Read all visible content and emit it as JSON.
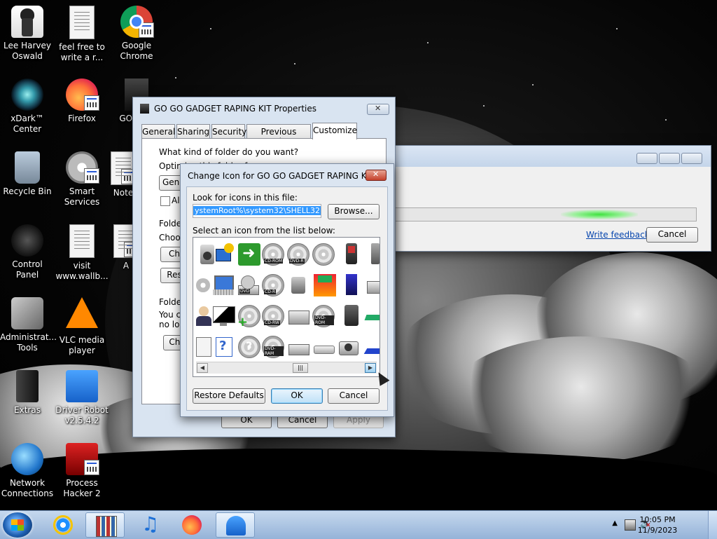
{
  "desktop": {
    "icons": [
      {
        "label": "Lee Harvey Oswald",
        "icon": "person-icon"
      },
      {
        "label": "feel free to write a r...",
        "icon": "text-document-icon"
      },
      {
        "label": "Google Chrome",
        "icon": "chrome-icon"
      },
      {
        "label": "xDark™ Center",
        "icon": "xdark-icon"
      },
      {
        "label": "Firefox",
        "icon": "firefox-icon"
      },
      {
        "label": "GO GAD",
        "icon": "folder-icon"
      },
      {
        "label": "Recycle Bin",
        "icon": "recycle-bin-icon"
      },
      {
        "label": "Smart Services",
        "icon": "gear-icon"
      },
      {
        "label": "Note",
        "icon": "shortcut-icon"
      },
      {
        "label": "Control Panel",
        "icon": "control-panel-icon"
      },
      {
        "label": "visit www.wallb...",
        "icon": "text-document-icon"
      },
      {
        "label": "A",
        "icon": "shortcut-icon"
      },
      {
        "label": "Administrat... Tools",
        "icon": "admin-tools-icon"
      },
      {
        "label": "VLC media player",
        "icon": "vlc-icon"
      },
      {
        "label": "Extras",
        "icon": "extras-icon"
      },
      {
        "label": "Driver Robot v2.5.4.2",
        "icon": "driver-robot-icon"
      },
      {
        "label": "Network Connections",
        "icon": "network-icon"
      },
      {
        "label": "Process Hacker 2",
        "icon": "process-hacker-icon"
      }
    ]
  },
  "properties_window": {
    "title": "GO GO GADGET RAPING KIT Properties",
    "tabs": [
      "General",
      "Sharing",
      "Security",
      "Previous Versions",
      "Customize"
    ],
    "active_tab": "Customize",
    "question": "What kind of folder do you want?",
    "optimize_label": "Optimize this folder for:",
    "optimize_value": "Gener",
    "also_apply_label": "Als",
    "folder_pictures_label": "Folder",
    "choose_label": "Choos",
    "choose_file_button": "Ch",
    "restore_button": "Res",
    "folder_icons_label": "Folder",
    "folder_icons_text_1": "You ca",
    "folder_icons_text_2": "no lon",
    "change_icon_button": "Cha",
    "ok": "OK",
    "cancel": "Cancel",
    "apply": "Apply"
  },
  "change_icon_dialog": {
    "title": "Change Icon for GO GO GADGET RAPING KIT ...",
    "look_label": "Look for icons in this file:",
    "file_path": "ystemRoot%\\system32\\SHELL32.dll",
    "browse_button": "Browse...",
    "select_label": "Select an icon from the list below:",
    "icon_tags": [
      "CD-ROM",
      "DVD-R",
      "DVD",
      "CD-R",
      "CD-RW",
      "DVD-ROM",
      "DVD-RAM"
    ],
    "restore_defaults_button": "Restore Defaults",
    "ok_button": "OK",
    "cancel_button": "Cancel"
  },
  "progress_window": {
    "progress_percent": 55,
    "feedback_link": "Write feedback",
    "cancel_button": "Cancel"
  },
  "taskbar": {
    "time": "10:05 PM",
    "date": "11/9/2023",
    "pinned": [
      "internet-explorer-icon",
      "library-icon",
      "music-icon",
      "firefox-icon",
      "app-icon"
    ]
  }
}
